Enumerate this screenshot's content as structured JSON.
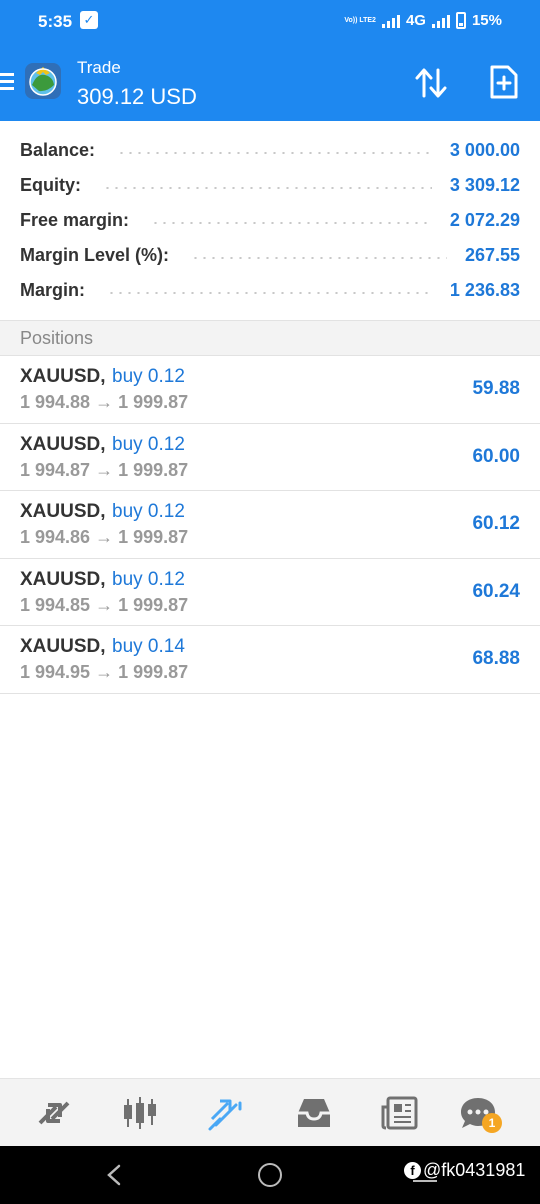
{
  "status_bar": {
    "time": "5:35",
    "network": "4G",
    "battery": "15%",
    "volte": "Vo)) LTE2"
  },
  "header": {
    "title": "Trade",
    "subtitle": "309.12 USD"
  },
  "summary": [
    {
      "label": "Balance:",
      "value": "3 000.00"
    },
    {
      "label": "Equity:",
      "value": "3 309.12"
    },
    {
      "label": "Free margin:",
      "value": "2 072.29"
    },
    {
      "label": "Margin Level (%):",
      "value": "267.55"
    },
    {
      "label": "Margin:",
      "value": "1 236.83"
    }
  ],
  "positions_header": "Positions",
  "positions": [
    {
      "symbol": "XAUUSD,",
      "side": "buy 0.12",
      "prices": "1 994.88 → 1 999.87",
      "profit": "59.88"
    },
    {
      "symbol": "XAUUSD,",
      "side": "buy 0.12",
      "prices": "1 994.87 → 1 999.87",
      "profit": "60.00"
    },
    {
      "symbol": "XAUUSD,",
      "side": "buy 0.12",
      "prices": "1 994.86 → 1 999.87",
      "profit": "60.12"
    },
    {
      "symbol": "XAUUSD,",
      "side": "buy 0.12",
      "prices": "1 994.85 → 1 999.87",
      "profit": "60.24"
    },
    {
      "symbol": "XAUUSD,",
      "side": "buy 0.14",
      "prices": "1 994.95 → 1 999.87",
      "profit": "68.88"
    }
  ],
  "bottom_nav": {
    "items": [
      {
        "icon": "quotes-icon"
      },
      {
        "icon": "chart-icon"
      },
      {
        "icon": "trade-icon",
        "active": true
      },
      {
        "icon": "history-icon"
      },
      {
        "icon": "news-icon"
      },
      {
        "icon": "chat-icon",
        "badge": "1"
      }
    ]
  },
  "watermark": "@fk0431981",
  "colors": {
    "header_bg": "#1e88f0",
    "value_blue": "#1e78d8",
    "active_nav": "#4aa8f5",
    "badge": "#f5a623"
  }
}
